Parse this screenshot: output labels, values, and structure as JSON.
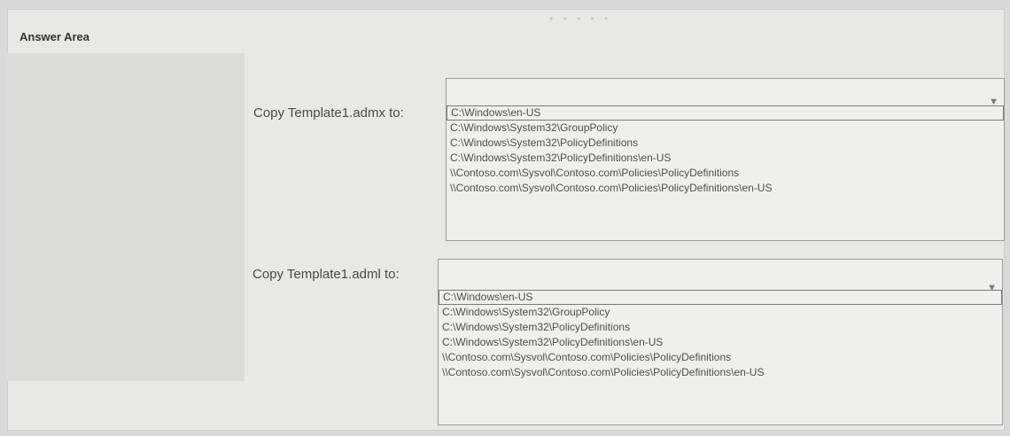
{
  "header": {
    "title": "Answer Area",
    "dots": "• • • • •"
  },
  "questions": [
    {
      "label": "Copy Template1.admx to:",
      "options": [
        "C:\\Windows\\en-US",
        "C:\\Windows\\System32\\GroupPolicy",
        "C:\\Windows\\System32\\PolicyDefinitions",
        "C:\\Windows\\System32\\PolicyDefinitions\\en-US",
        "\\\\Contoso.com\\Sysvol\\Contoso.com\\Policies\\PolicyDefinitions",
        "\\\\Contoso.com\\Sysvol\\Contoso.com\\Policies\\PolicyDefinitions\\en-US"
      ]
    },
    {
      "label": "Copy Template1.adml to:",
      "options": [
        "C:\\Windows\\en-US",
        "C:\\Windows\\System32\\GroupPolicy",
        "C:\\Windows\\System32\\PolicyDefinitions",
        "C:\\Windows\\System32\\PolicyDefinitions\\en-US",
        "\\\\Contoso.com\\Sysvol\\Contoso.com\\Policies\\PolicyDefinitions",
        "\\\\Contoso.com\\Sysvol\\Contoso.com\\Policies\\PolicyDefinitions\\en-US"
      ]
    }
  ],
  "icons": {
    "dropdown_arrow": "▼"
  }
}
